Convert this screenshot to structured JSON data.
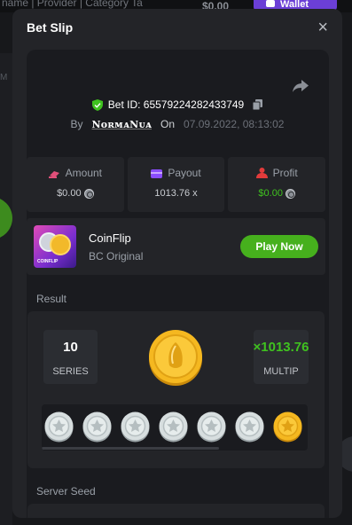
{
  "background": {
    "breadcrumb": "name | Provider | Category Ta",
    "balance": "$0.00",
    "wallet_label": "Wallet",
    "side_letter": "M"
  },
  "modal": {
    "title": "Bet Slip",
    "close_glyph": "×"
  },
  "bet": {
    "id_text": "Bet ID: 65579224282433749",
    "by_label": "By",
    "username": "NᴏʀᴍᴀNᴜᴀ",
    "on_label": "On",
    "date": "07.09.2022, 08:13:02"
  },
  "stats": [
    {
      "label": "Amount",
      "value": "$0.00",
      "icon": "coins-stack-icon",
      "icon_color": "#e14f7a"
    },
    {
      "label": "Payout",
      "value": "1013.76 x",
      "icon": "wallet-card-icon",
      "icon_color": "#8a4dff"
    },
    {
      "label": "Profit",
      "value": "$0.00",
      "icon": "profit-people-icon",
      "icon_color": "#e23b3b",
      "value_color": "#3fc21f"
    }
  ],
  "game": {
    "name": "CoinFlip",
    "subtitle": "BC Original",
    "thumb_text": "COINFLIP",
    "play_label": "Play Now"
  },
  "result": {
    "label": "Result",
    "series_value": "10",
    "series_label": "SERIES",
    "multiplier_value": "×1013.76",
    "multiplier_label": "MULTIP",
    "coin_sequence": [
      "silver",
      "silver",
      "silver",
      "silver",
      "silver",
      "silver",
      "gold"
    ]
  },
  "server_seed": {
    "label": "Server Seed"
  },
  "colors": {
    "accent_green": "#46b01d",
    "modal_bg": "#232428",
    "panel_bg": "#1a1b1f"
  }
}
